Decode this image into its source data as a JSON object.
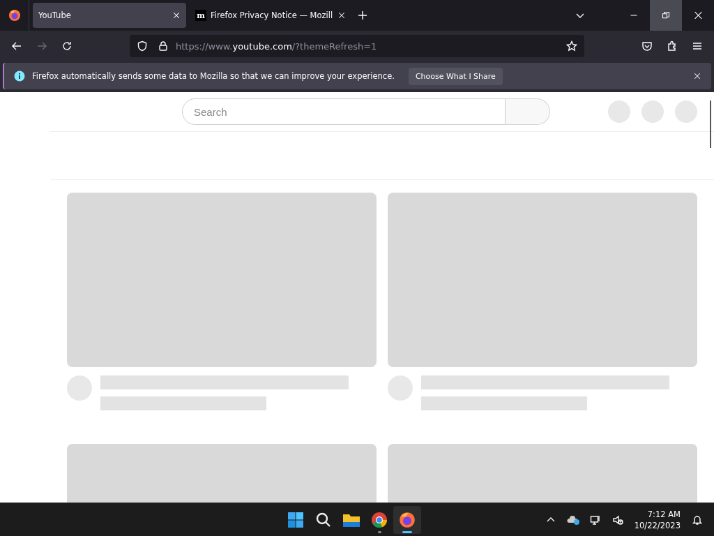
{
  "tabs": [
    {
      "title": "YouTube",
      "selected": true
    },
    {
      "title": "Firefox Privacy Notice — Mozill",
      "selected": false,
      "favicon": "m"
    }
  ],
  "nav": {
    "url": "https://www.**youtube.com**/?themeRefresh=1",
    "forward_disabled": true
  },
  "notification": {
    "message": "Firefox automatically sends some data to Mozilla so that we can improve your experience.",
    "button": "Choose What I Share"
  },
  "page": {
    "search": {
      "placeholder": "Search"
    },
    "cards": [
      {
        "kind": "full"
      },
      {
        "kind": "full"
      },
      {
        "kind": "cut"
      },
      {
        "kind": "cut"
      }
    ]
  },
  "taskbar": {
    "apps": [
      {
        "kind": "start",
        "active": false
      },
      {
        "kind": "search",
        "active": false
      },
      {
        "kind": "files",
        "active": false
      },
      {
        "kind": "chrome",
        "active": false
      },
      {
        "kind": "firefox",
        "active": true
      }
    ],
    "time": "7:12 AM",
    "date": "10/22/2023"
  }
}
